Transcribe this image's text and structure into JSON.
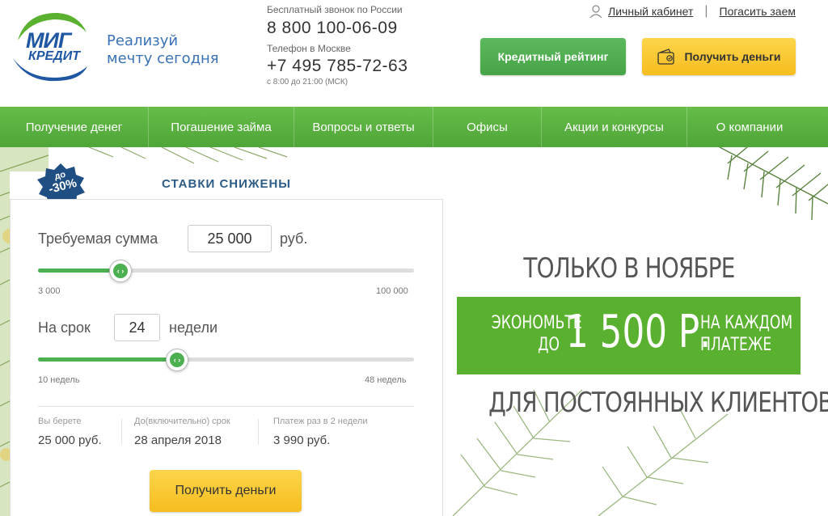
{
  "brand": {
    "logo_line1": "МИГ",
    "logo_line2": "КРЕДИТ",
    "slogan_line1": "Реализуй",
    "slogan_line2": "мечту сегодня",
    "primary_color": "#1f57a3",
    "accent_green": "#4caf50",
    "accent_yellow": "#f6bd1f"
  },
  "contacts": {
    "free_caption": "Бесплатный звонок по России",
    "free_phone": "8 800 100-06-09",
    "moscow_caption": "Телефон в Москве",
    "moscow_phone": "+7 495 785-72-63",
    "hours": "с 8:00 до 21:00 (МСК)"
  },
  "top_links": {
    "cabinet": "Личный кабинет",
    "repay": "Погасить заем"
  },
  "header_buttons": {
    "rating": "Кредитный рейтинг",
    "get_money": "Получить деньги"
  },
  "nav": [
    "Получение денег",
    "Погашение займа",
    "Вопросы и ответы",
    "Офисы",
    "Акции и конкурсы",
    "О компании"
  ],
  "badge": {
    "line1": "до",
    "line2": "-30%"
  },
  "promo_title": "СТАВКИ СНИЖЕНЫ",
  "calculator": {
    "amount_label": "Требуемая сумма",
    "amount_value": "25 000",
    "amount_unit": "руб.",
    "amount_min": "3 000",
    "amount_max": "100 000",
    "amount_fraction": 0.22,
    "term_label": "На срок",
    "term_value": "24",
    "term_unit": "недели",
    "term_min": "10 недель",
    "term_max": "48 недель",
    "term_fraction": 0.37,
    "summary": [
      {
        "caption": "Вы берете",
        "value": "25 000 руб."
      },
      {
        "caption": "До(включительно) срок",
        "value": "28 апреля 2018"
      },
      {
        "caption": "Платеж раз в 2 недели",
        "value": "3 990 руб."
      }
    ],
    "submit": "Получить деньги"
  },
  "offer": {
    "line1": "ТОЛЬКО В НОЯБРЕ",
    "save_line1": "ЭКОНОМЬТЕ",
    "save_line2": "ДО",
    "amount": "1 500 Р.",
    "per_line1": "НА КАЖДОМ",
    "per_line2": "ПЛАТЕЖЕ",
    "line3": "ДЛЯ ПОСТОЯННЫХ КЛИЕНТОВ"
  }
}
